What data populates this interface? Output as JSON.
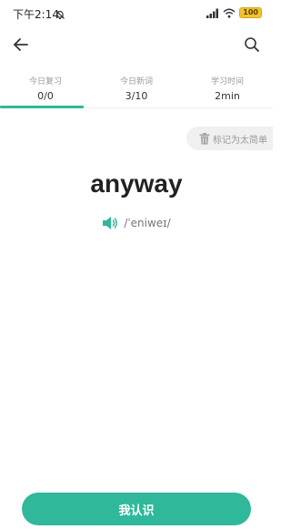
{
  "status_bar": {
    "time": "下午2:14",
    "battery": "100",
    "icons": [
      "notification-off-icon",
      "signal-icon",
      "wifi-icon",
      "battery-icon"
    ]
  },
  "toolbar": {
    "back_icon": "arrow-left-icon",
    "search_icon": "search-icon"
  },
  "stats": [
    {
      "label": "今日复习",
      "value": "0/0"
    },
    {
      "label": "今日新词",
      "value": "3/10"
    },
    {
      "label": "学习时间",
      "value": "2min"
    }
  ],
  "mark_easy": {
    "label": "标记为太简单",
    "icon": "trash-icon"
  },
  "word": {
    "text": "anyway",
    "phonetic": "/ˈeniweɪ/",
    "speaker_icon": "speaker-icon"
  },
  "know_button": {
    "label": "我认识"
  },
  "colors": {
    "accent": "#2fb89a",
    "text": "#222222",
    "muted": "#999999",
    "battery": "#f2c230"
  }
}
